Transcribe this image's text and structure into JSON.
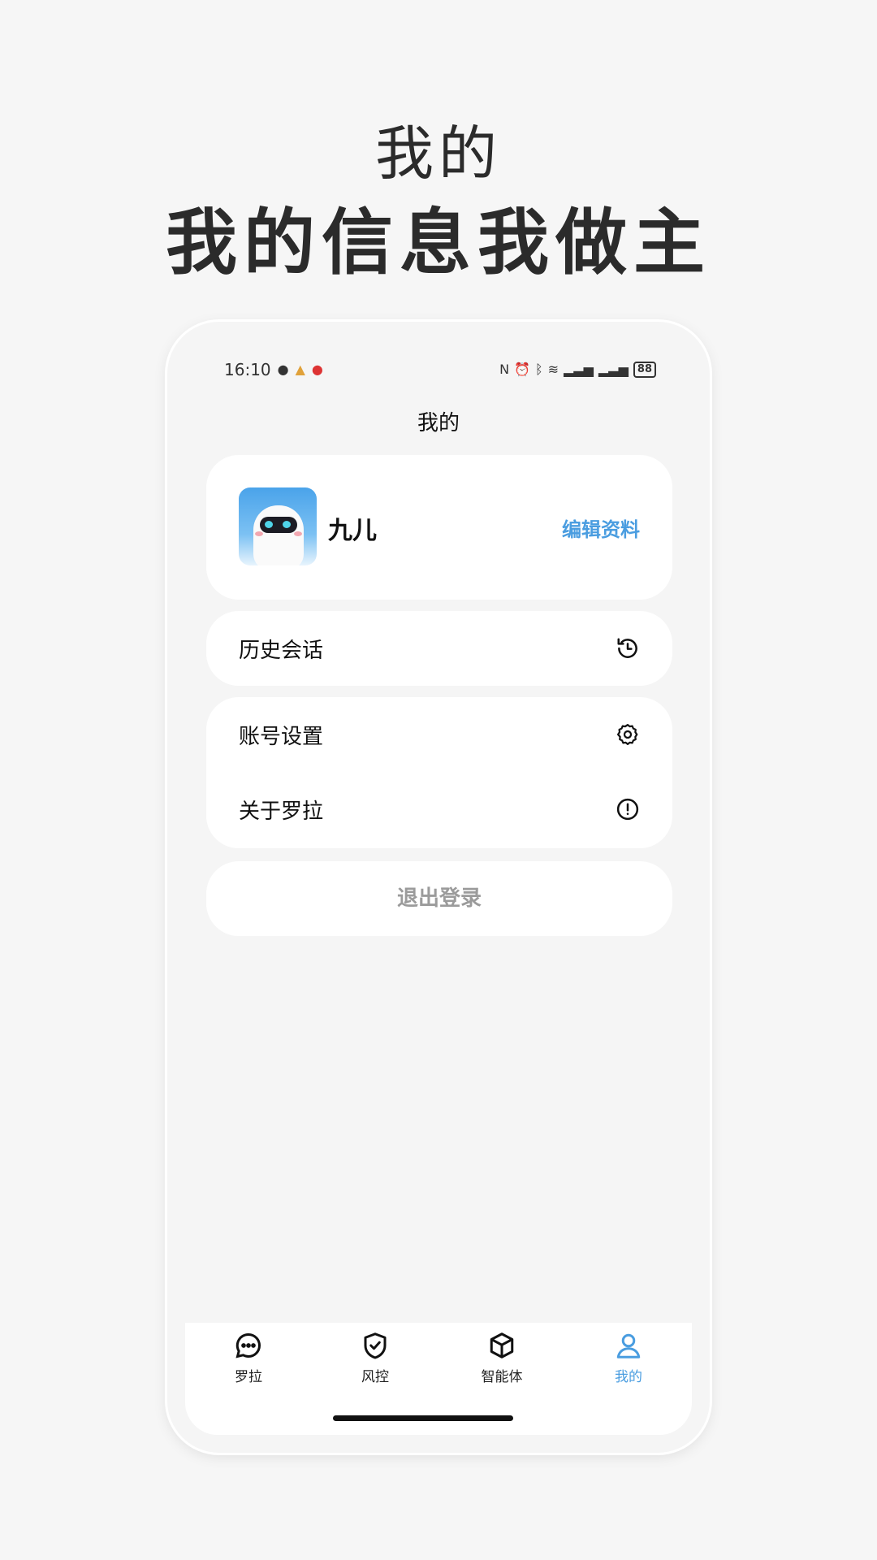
{
  "promo": {
    "title": "我的",
    "headline": "我的信息我做主"
  },
  "status_bar": {
    "time": "16:10",
    "battery": "88",
    "left_icons": [
      "chat-bubble-icon",
      "app-notification-icon",
      "app-badge-icon"
    ],
    "right_icons": [
      "nfc-icon",
      "alarm-icon",
      "bluetooth-icon",
      "wifi-icon",
      "signal-5g-icon",
      "signal-5g-icon",
      "battery-icon"
    ]
  },
  "header": {
    "title": "我的"
  },
  "profile": {
    "name": "九儿",
    "edit_label": "编辑资料"
  },
  "menu": {
    "history_label": "历史会话",
    "account_label": "账号设置",
    "about_label": "关于罗拉"
  },
  "logout": {
    "label": "退出登录"
  },
  "tabs": [
    {
      "label": "罗拉",
      "icon": "chat-icon",
      "active": false
    },
    {
      "label": "风控",
      "icon": "shield-check-icon",
      "active": false
    },
    {
      "label": "智能体",
      "icon": "cube-icon",
      "active": false
    },
    {
      "label": "我的",
      "icon": "person-icon",
      "active": true
    }
  ],
  "colors": {
    "accent": "#4a9de0",
    "background": "#f6f6f6",
    "card": "#ffffff",
    "muted": "#9b9b9b"
  }
}
